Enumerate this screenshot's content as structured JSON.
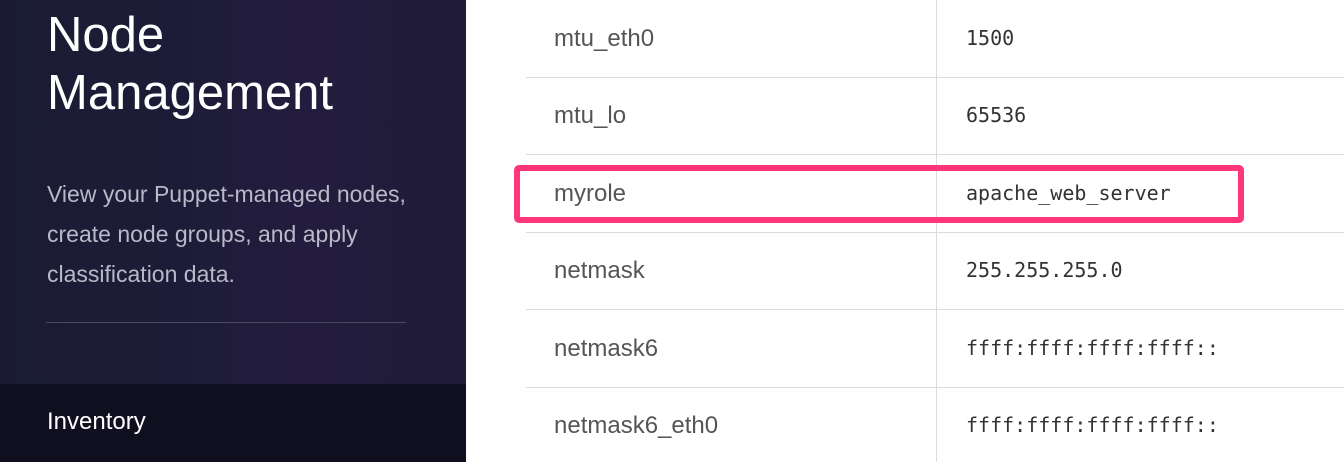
{
  "sidebar": {
    "title": "Node Management",
    "description": "View your Puppet-managed nodes, create node groups, and apply classification data.",
    "nav": {
      "inventory_label": "Inventory"
    }
  },
  "facts": {
    "rows": [
      {
        "name": "mtu_eth0",
        "value": "1500"
      },
      {
        "name": "mtu_lo",
        "value": "65536"
      },
      {
        "name": "myrole",
        "value": "apache_web_server"
      },
      {
        "name": "netmask",
        "value": "255.255.255.0"
      },
      {
        "name": "netmask6",
        "value": "ffff:ffff:ffff:ffff::"
      },
      {
        "name": "netmask6_eth0",
        "value": "ffff:ffff:ffff:ffff::"
      }
    ],
    "highlighted_row": "myrole"
  },
  "colors": {
    "sidebar_bg": "#1d1c38",
    "nav_bg": "#100f1f",
    "highlight": "#ff3677",
    "row_border": "#dcdcdc"
  }
}
